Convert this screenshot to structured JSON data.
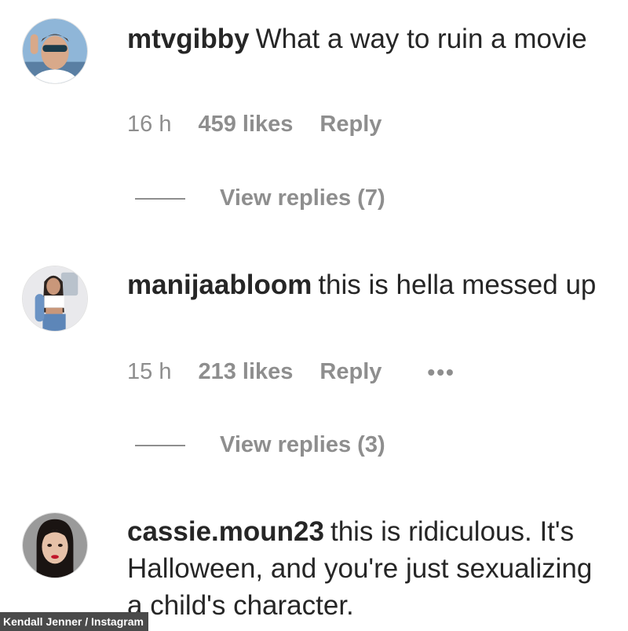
{
  "comments": [
    {
      "username": "mtvgibby",
      "text": "What a way to ruin a movie",
      "time": "16 h",
      "likes": "459 likes",
      "reply_label": "Reply",
      "view_replies": "View replies (7)"
    },
    {
      "username": "manijaabloom",
      "text": "this is hella messed up",
      "time": "15 h",
      "likes": "213 likes",
      "reply_label": "Reply",
      "more_icon": "more-horizontal-icon",
      "view_replies": "View replies (3)"
    },
    {
      "username": "cassie.moun23",
      "text": "this is ridiculous. It's Halloween, and you're just sexualizing a child's character."
    }
  ],
  "credit": "Kendall Jenner / Instagram"
}
